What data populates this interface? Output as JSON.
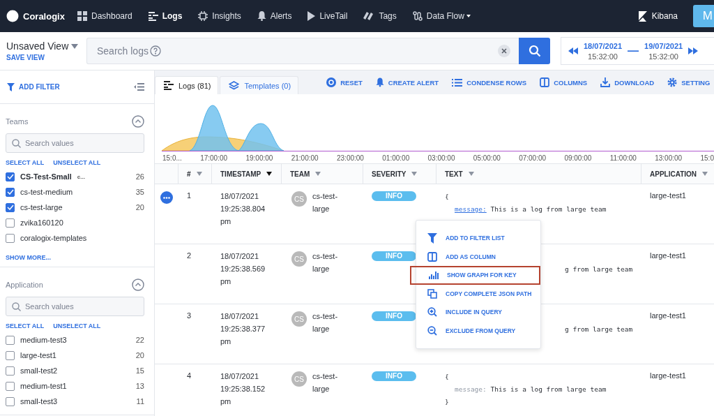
{
  "nav": {
    "brand": "Coralogix",
    "items": [
      {
        "label": "Dashboard",
        "selected": false,
        "dropdown": false
      },
      {
        "label": "Logs",
        "selected": true,
        "dropdown": false
      },
      {
        "label": "Insights",
        "selected": false,
        "dropdown": false
      },
      {
        "label": "Alerts",
        "selected": false,
        "dropdown": false
      },
      {
        "label": "LiveTail",
        "selected": false,
        "dropdown": false
      },
      {
        "label": "Tags",
        "selected": false,
        "dropdown": false
      },
      {
        "label": "Data Flow",
        "selected": false,
        "dropdown": true
      }
    ],
    "kibana": "Kibana",
    "avatar": "M"
  },
  "view": {
    "title": "Unsaved View",
    "save": "SAVE VIEW"
  },
  "search": {
    "placeholder": "Search logs"
  },
  "date_range": {
    "from_date": "18/07/2021",
    "from_time": "15:32:00",
    "separator": "—",
    "to_date": "19/07/2021",
    "to_time": "15:32:00"
  },
  "sidebar": {
    "add_filter": "ADD FILTER",
    "sections": [
      {
        "title": "Teams",
        "expanded": true,
        "search_placeholder": "Search values",
        "select_all": "SELECT ALL",
        "unselect_all": "UNSELECT ALL",
        "show_more": "SHOW MORE...",
        "items": [
          {
            "label": "CS-Test-Small",
            "note": "c...",
            "bold": true,
            "checked": true,
            "count": "26"
          },
          {
            "label": "cs-test-medium",
            "bold": false,
            "checked": true,
            "count": "35"
          },
          {
            "label": "cs-test-large",
            "bold": false,
            "checked": true,
            "count": "20"
          },
          {
            "label": "zvika160120",
            "bold": false,
            "checked": false
          },
          {
            "label": "coralogix-templates",
            "bold": false,
            "checked": false
          }
        ]
      },
      {
        "title": "Application",
        "expanded": true,
        "search_placeholder": "Search values",
        "select_all": "SELECT ALL",
        "unselect_all": "UNSELECT ALL",
        "items": [
          {
            "label": "medium-test3",
            "bold": false,
            "checked": false,
            "count": "22"
          },
          {
            "label": "large-test1",
            "bold": false,
            "checked": false,
            "count": "20"
          },
          {
            "label": "small-test2",
            "bold": false,
            "checked": false,
            "count": "15"
          },
          {
            "label": "medium-test1",
            "bold": false,
            "checked": false,
            "count": "13"
          },
          {
            "label": "small-test3",
            "bold": false,
            "checked": false,
            "count": "11"
          }
        ]
      }
    ]
  },
  "tabs": [
    {
      "label": "Logs (81)",
      "selected": true
    },
    {
      "label": "Templates (0)",
      "selected": false
    }
  ],
  "toolbar": [
    "RESET",
    "CREATE ALERT",
    "CONDENSE ROWS",
    "COLUMNS",
    "DOWNLOAD",
    "SETTING"
  ],
  "histogram": {
    "x_labels": [
      "15:0...",
      "17:00:00",
      "19:00:00",
      "21:00:00",
      "23:00:00",
      "01:00:00",
      "03:00:00",
      "05:00:00",
      "07:00:00",
      "09:00:00",
      "11:00:00",
      "13:00:00",
      "15:0"
    ]
  },
  "table": {
    "columns": [
      {
        "label": "#",
        "sorted": false
      },
      {
        "label": "TIMESTAMP",
        "sorted": true
      },
      {
        "label": "TEAM",
        "sorted": false
      },
      {
        "label": "SEVERITY",
        "sorted": false
      },
      {
        "label": "TEXT",
        "sorted": false
      },
      {
        "label": "APPLICATION",
        "sorted": false
      }
    ],
    "rows": [
      {
        "number": "1",
        "date": "18/07/2021",
        "time": "19:25:38.804",
        "ampm": "pm",
        "initials": "CS",
        "team_1": "cs-test-",
        "team_2": "large",
        "severity": "INFO",
        "open": "{",
        "key": "message:",
        "key_link": true,
        "value": "This is a log from large team",
        "application": "large-test1",
        "actions": true
      },
      {
        "number": "2",
        "date": "18/07/2021",
        "time": "19:25:38.569",
        "ampm": "pm",
        "initials": "CS",
        "team_1": "cs-test-",
        "team_2": "large",
        "severity": "INFO",
        "fragment": "g from large team",
        "application": "large-test1",
        "actions": false
      },
      {
        "number": "3",
        "date": "18/07/2021",
        "time": "19:25:38.377",
        "ampm": "pm",
        "initials": "CS",
        "team_1": "cs-test-",
        "team_2": "large",
        "severity": "INFO",
        "fragment": "g from large team",
        "application": "large-test1",
        "actions": false
      },
      {
        "number": "4",
        "date": "18/07/2021",
        "time": "19:25:38.152",
        "ampm": "pm",
        "initials": "CS",
        "team_1": "cs-test-",
        "team_2": "large",
        "severity": "INFO",
        "open": "{",
        "key": "message:",
        "key_link": false,
        "value": "This is a log from large team",
        "close": "}",
        "application": "large-test1",
        "actions": false
      }
    ]
  },
  "context_menu": {
    "items": [
      {
        "label": "ADD TO FILTER LIST",
        "highlighted": false
      },
      {
        "label": "ADD AS COLUMN",
        "highlighted": false
      },
      {
        "label": "SHOW GRAPH FOR KEY",
        "highlighted": true
      },
      {
        "label": "COPY COMPLETE JSON PATH",
        "highlighted": false
      },
      {
        "label": "INCLUDE IN QUERY",
        "highlighted": false
      },
      {
        "label": "EXCLUDE FROM QUERY",
        "highlighted": false
      }
    ]
  }
}
